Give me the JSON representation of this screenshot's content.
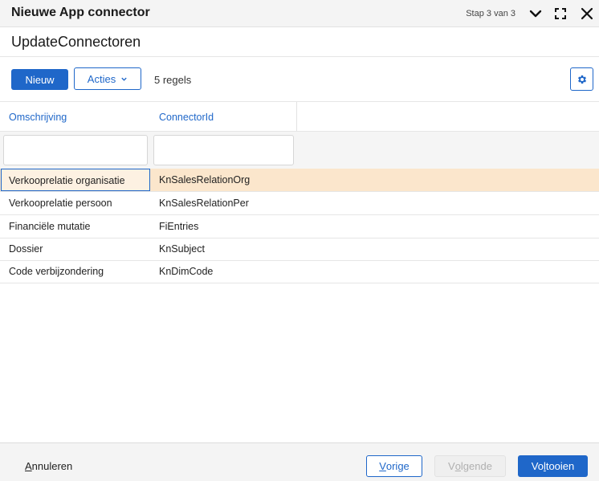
{
  "window": {
    "title": "Nieuwe App connector",
    "step": "Stap 3 van 3",
    "icons": [
      "chevron-down-icon",
      "fullscreen-icon",
      "close-icon"
    ]
  },
  "page": {
    "subtitle": "UpdateConnectoren"
  },
  "toolbar": {
    "new_label": "Nieuw",
    "actions_label": "Acties",
    "row_count": "5 regels",
    "settings_icon": "gear-icon"
  },
  "table": {
    "columns": [
      "Omschrijving",
      "ConnectorId"
    ],
    "filters": [
      "",
      ""
    ],
    "rows": [
      {
        "omschrijving": "Verkooprelatie organisatie",
        "connector_id": "KnSalesRelationOrg",
        "selected": true
      },
      {
        "omschrijving": "Verkooprelatie persoon",
        "connector_id": "KnSalesRelationPer",
        "selected": false
      },
      {
        "omschrijving": "Financiële mutatie",
        "connector_id": "FiEntries",
        "selected": false
      },
      {
        "omschrijving": "Dossier",
        "connector_id": "KnSubject",
        "selected": false
      },
      {
        "omschrijving": "Code verbijzondering",
        "connector_id": "KnDimCode",
        "selected": false
      }
    ]
  },
  "footer": {
    "cancel_accel": "A",
    "cancel_rest": "nnuleren",
    "prev_accel": "V",
    "prev_rest": "orige",
    "next_pre": "V",
    "next_accel": "o",
    "next_rest": "lgende",
    "finish_pre": "Vo",
    "finish_accel": "l",
    "finish_rest": "tooien"
  },
  "colors": {
    "accent": "#1f67c9",
    "selected_row": "#fbe6cc",
    "header_bg": "#f4f4f4"
  }
}
